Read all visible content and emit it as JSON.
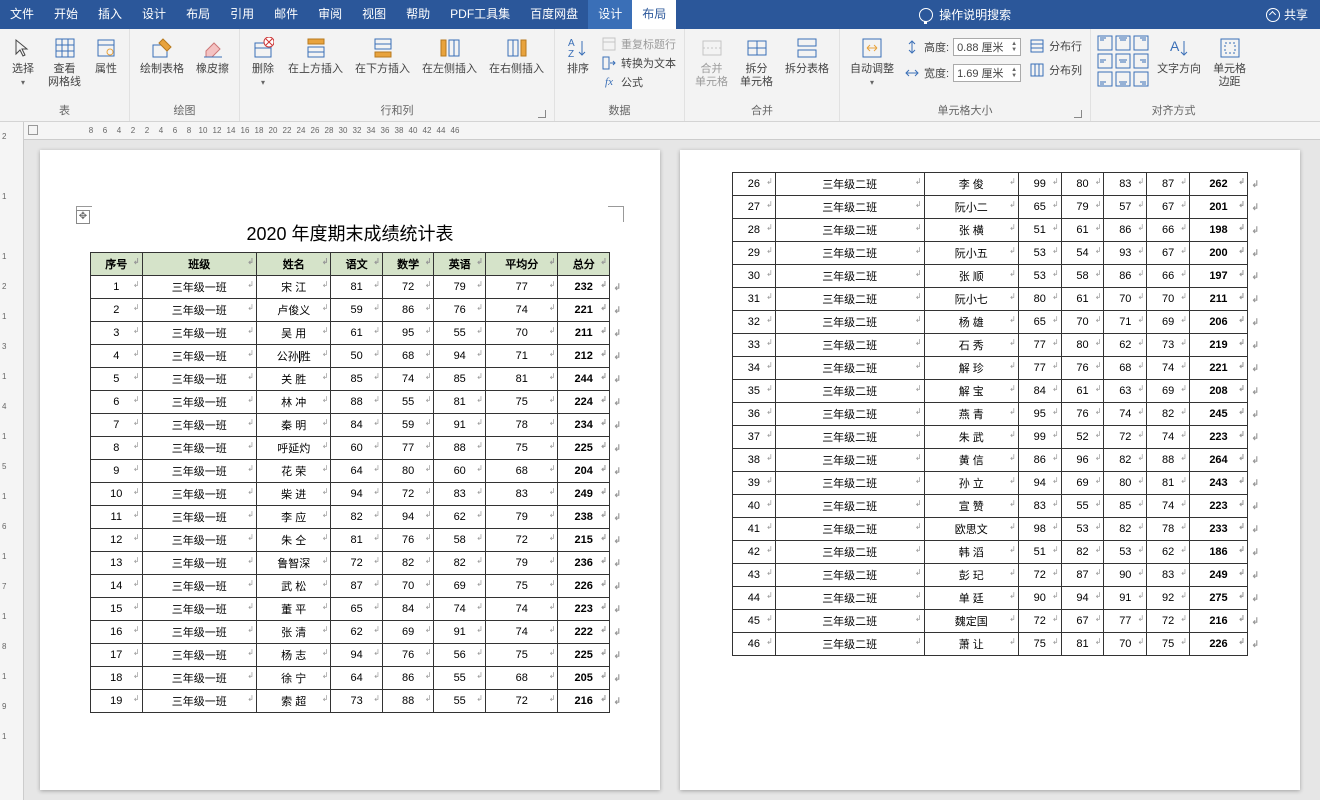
{
  "menubar": {
    "items": [
      "文件",
      "开始",
      "插入",
      "设计",
      "布局",
      "引用",
      "邮件",
      "审阅",
      "视图",
      "帮助",
      "PDF工具集",
      "百度网盘",
      "设计",
      "布局"
    ],
    "active_index": 13,
    "context_index": 12,
    "help_placeholder": "操作说明搜索",
    "share": "共享"
  },
  "ribbon": {
    "groups": {
      "table": {
        "label": "表",
        "select": "选择",
        "view_grid": "查看\n网格线",
        "properties": "属性"
      },
      "draw": {
        "label": "绘图",
        "draw_table": "绘制表格",
        "eraser": "橡皮擦"
      },
      "rows_cols": {
        "label": "行和列",
        "delete": "删除",
        "ins_above": "在上方插入",
        "ins_below": "在下方插入",
        "ins_left": "在左侧插入",
        "ins_right": "在右侧插入"
      },
      "sort": {
        "label": "排序",
        "sort_btn": "排序"
      },
      "data": {
        "label": "数据",
        "repeat_header": "重复标题行",
        "convert": "转换为文本",
        "formula": "公式"
      },
      "merge": {
        "label": "合并",
        "merge_cells": "合并\n单元格",
        "split_cells": "拆分\n单元格",
        "split_table": "拆分表格"
      },
      "autofit": {
        "label": "",
        "autofit": "自动调整"
      },
      "cell_size": {
        "label": "单元格大小",
        "height_lbl": "高度:",
        "width_lbl": "宽度:",
        "height_val": "0.88 厘米",
        "width_val": "1.69 厘米",
        "dist_rows": "分布行",
        "dist_cols": "分布列"
      },
      "align": {
        "label": "对齐方式",
        "text_dir": "文字方向",
        "cell_margin": "单元格\n边距"
      }
    }
  },
  "ruler_h": [
    8,
    6,
    4,
    2,
    2,
    4,
    6,
    8,
    10,
    12,
    14,
    16,
    18,
    20,
    22,
    24,
    26,
    28,
    30,
    32,
    34,
    36,
    38,
    40,
    42,
    44,
    46
  ],
  "ruler_v": [
    2,
    "",
    1,
    "",
    1,
    2,
    1,
    3,
    1,
    4,
    1,
    5,
    1,
    6,
    1,
    7,
    1,
    8,
    1,
    9,
    1
  ],
  "doc_title": "2020 年度期末成绩统计表",
  "headers": [
    "序号",
    "班级",
    "姓名",
    "语文",
    "数学",
    "英语",
    "平均分",
    "总分"
  ],
  "rows_page1": [
    [
      "1",
      "三年级一班",
      "宋 江",
      "81",
      "72",
      "79",
      "77",
      "232"
    ],
    [
      "2",
      "三年级一班",
      "卢俊义",
      "59",
      "86",
      "76",
      "74",
      "221"
    ],
    [
      "3",
      "三年级一班",
      "吴 用",
      "61",
      "95",
      "55",
      "70",
      "211"
    ],
    [
      "4",
      "三年级一班",
      "公孙胜",
      "50",
      "68",
      "94",
      "71",
      "212"
    ],
    [
      "5",
      "三年级一班",
      "关 胜",
      "85",
      "74",
      "85",
      "81",
      "244"
    ],
    [
      "6",
      "三年级一班",
      "林 冲",
      "88",
      "55",
      "81",
      "75",
      "224"
    ],
    [
      "7",
      "三年级一班",
      "秦 明",
      "84",
      "59",
      "91",
      "78",
      "234"
    ],
    [
      "8",
      "三年级一班",
      "呼延灼",
      "60",
      "77",
      "88",
      "75",
      "225"
    ],
    [
      "9",
      "三年级一班",
      "花 荣",
      "64",
      "80",
      "60",
      "68",
      "204"
    ],
    [
      "10",
      "三年级一班",
      "柴 进",
      "94",
      "72",
      "83",
      "83",
      "249"
    ],
    [
      "11",
      "三年级一班",
      "李 应",
      "82",
      "94",
      "62",
      "79",
      "238"
    ],
    [
      "12",
      "三年级一班",
      "朱 仝",
      "81",
      "76",
      "58",
      "72",
      "215"
    ],
    [
      "13",
      "三年级一班",
      "鲁智深",
      "72",
      "82",
      "82",
      "79",
      "236"
    ],
    [
      "14",
      "三年级一班",
      "武 松",
      "87",
      "70",
      "69",
      "75",
      "226"
    ],
    [
      "15",
      "三年级一班",
      "董 平",
      "65",
      "84",
      "74",
      "74",
      "223"
    ],
    [
      "16",
      "三年级一班",
      "张 清",
      "62",
      "69",
      "91",
      "74",
      "222"
    ],
    [
      "17",
      "三年级一班",
      "杨 志",
      "94",
      "76",
      "56",
      "75",
      "225"
    ],
    [
      "18",
      "三年级一班",
      "徐 宁",
      "64",
      "86",
      "55",
      "68",
      "205"
    ],
    [
      "19",
      "三年级一班",
      "索 超",
      "73",
      "88",
      "55",
      "72",
      "216"
    ]
  ],
  "rows_page2": [
    [
      "26",
      "三年级二班",
      "李 俊",
      "99",
      "80",
      "83",
      "87",
      "262"
    ],
    [
      "27",
      "三年级二班",
      "阮小二",
      "65",
      "79",
      "57",
      "67",
      "201"
    ],
    [
      "28",
      "三年级二班",
      "张 横",
      "51",
      "61",
      "86",
      "66",
      "198"
    ],
    [
      "29",
      "三年级二班",
      "阮小五",
      "53",
      "54",
      "93",
      "67",
      "200"
    ],
    [
      "30",
      "三年级二班",
      "张 顺",
      "53",
      "58",
      "86",
      "66",
      "197"
    ],
    [
      "31",
      "三年级二班",
      "阮小七",
      "80",
      "61",
      "70",
      "70",
      "211"
    ],
    [
      "32",
      "三年级二班",
      "杨 雄",
      "65",
      "70",
      "71",
      "69",
      "206"
    ],
    [
      "33",
      "三年级二班",
      "石 秀",
      "77",
      "80",
      "62",
      "73",
      "219"
    ],
    [
      "34",
      "三年级二班",
      "解 珍",
      "77",
      "76",
      "68",
      "74",
      "221"
    ],
    [
      "35",
      "三年级二班",
      "解 宝",
      "84",
      "61",
      "63",
      "69",
      "208"
    ],
    [
      "36",
      "三年级二班",
      "燕 青",
      "95",
      "76",
      "74",
      "82",
      "245"
    ],
    [
      "37",
      "三年级二班",
      "朱 武",
      "99",
      "52",
      "72",
      "74",
      "223"
    ],
    [
      "38",
      "三年级二班",
      "黄 信",
      "86",
      "96",
      "82",
      "88",
      "264"
    ],
    [
      "39",
      "三年级二班",
      "孙 立",
      "94",
      "69",
      "80",
      "81",
      "243"
    ],
    [
      "40",
      "三年级二班",
      "宣 赞",
      "83",
      "55",
      "85",
      "74",
      "223"
    ],
    [
      "41",
      "三年级二班",
      "欧思文",
      "98",
      "53",
      "82",
      "78",
      "233"
    ],
    [
      "42",
      "三年级二班",
      "韩 滔",
      "51",
      "82",
      "53",
      "62",
      "186"
    ],
    [
      "43",
      "三年级二班",
      "彭 玘",
      "72",
      "87",
      "90",
      "83",
      "249"
    ],
    [
      "44",
      "三年级二班",
      "单 廷",
      "90",
      "94",
      "91",
      "92",
      "275"
    ],
    [
      "45",
      "三年级二班",
      "魏定国",
      "72",
      "67",
      "77",
      "72",
      "216"
    ],
    [
      "46",
      "三年级二班",
      "萧 让",
      "75",
      "81",
      "70",
      "75",
      "226"
    ]
  ]
}
